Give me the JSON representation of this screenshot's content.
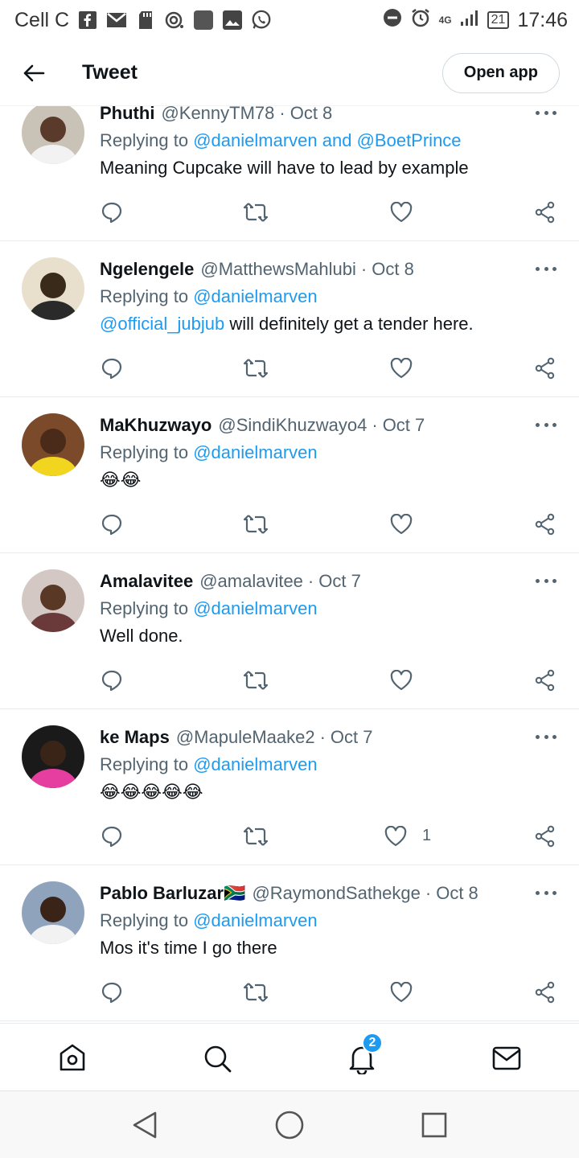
{
  "status_bar": {
    "carrier": "Cell C",
    "network": "4G",
    "battery": "21",
    "time": "17:46"
  },
  "header": {
    "title": "Tweet",
    "open_app_label": "Open app"
  },
  "tweets": [
    {
      "name": "Phuthi",
      "handle": "@KennyTM78",
      "date": "Oct 8",
      "replying_prefix": "Replying to",
      "mentions": [
        "@danielmarven",
        "@BoetPrince"
      ],
      "mention_joiner": "and",
      "text": "Meaning Cupcake will have to lead by example",
      "likes": ""
    },
    {
      "name": "Ngelengele",
      "handle": "@MatthewsMahlubi",
      "date": "Oct 8",
      "replying_prefix": "Replying to",
      "mentions": [
        "@danielmarven"
      ],
      "text_mention": "@official_jubjub",
      "text": "will definitely get a tender here.",
      "likes": ""
    },
    {
      "name": "MaKhuzwayo",
      "handle": "@SindiKhuzwayo4",
      "date": "Oct 7",
      "replying_prefix": "Replying to",
      "mentions": [
        "@danielmarven"
      ],
      "text": "😂😂",
      "likes": ""
    },
    {
      "name": "Amalavitee",
      "handle": "@amalavitee",
      "date": "Oct 7",
      "replying_prefix": "Replying to",
      "mentions": [
        "@danielmarven"
      ],
      "text": "Well done.",
      "likes": ""
    },
    {
      "name": "ke Maps",
      "handle": "@MapuleMaake2",
      "date": "Oct 7",
      "replying_prefix": "Replying to",
      "mentions": [
        "@danielmarven"
      ],
      "text": "😂😂😂😂😂",
      "likes": "1"
    },
    {
      "name": "Pablo Barluzar🇿🇦",
      "handle": "@RaymondSathekge",
      "date": "Oct 8",
      "replying_prefix": "Replying to",
      "mentions": [
        "@danielmarven"
      ],
      "text": "Mos it's time I go there",
      "likes": ""
    }
  ],
  "bottom_nav": {
    "notifications_badge": "2",
    "items": [
      "home-icon",
      "search-icon",
      "bell-icon",
      "mail-icon"
    ]
  },
  "colors": {
    "accent": "#1d9bf0",
    "text_primary": "#0f1419",
    "text_secondary": "#536471"
  }
}
